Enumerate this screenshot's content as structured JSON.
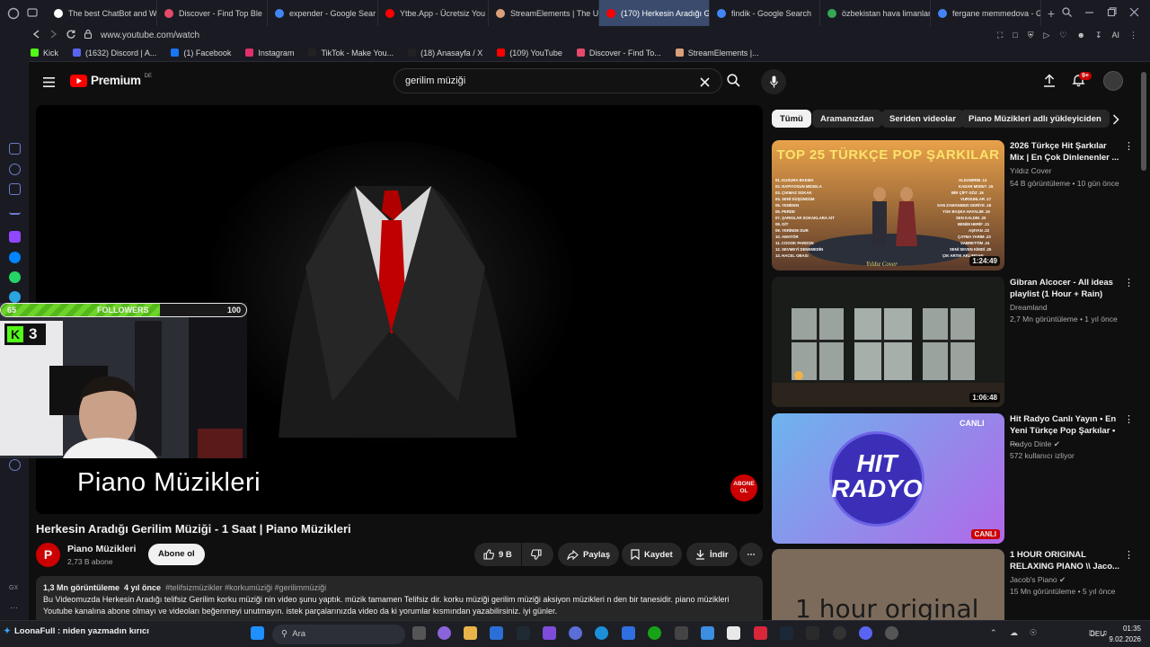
{
  "tabs": [
    {
      "label": "The best ChatBot and W",
      "color": "#ffffff",
      "active": false
    },
    {
      "label": "Discover - Find Top Ble",
      "color": "#e54a6a",
      "active": false
    },
    {
      "label": "expender - Google Sear",
      "color": "#4285f4",
      "active": false
    },
    {
      "label": "Ytbe.App - Ücretsiz You",
      "color": "#ff0000",
      "active": false
    },
    {
      "label": "StreamElements | The U",
      "color": "#d9a07a",
      "active": false
    },
    {
      "label": "(170) Herkesin Aradığı Ger",
      "color": "#ff0000",
      "active": true
    },
    {
      "label": "findik - Google Search",
      "color": "#4285f4",
      "active": false
    },
    {
      "label": "özbekistan hava limanları",
      "color": "#34a853",
      "active": false
    },
    {
      "label": "fergane memmedova - G",
      "color": "#4285f4",
      "active": false
    }
  ],
  "address": {
    "url": "www.youtube.com/watch",
    "ai_label": "AI"
  },
  "bookmarks": [
    {
      "label": "Kick",
      "color": "#53fc18"
    },
    {
      "label": "(1632) Discord | A...",
      "color": "#5865f2"
    },
    {
      "label": "(1) Facebook",
      "color": "#1877f2"
    },
    {
      "label": "Instagram",
      "color": "#e1306c"
    },
    {
      "label": "TikTok - Make You...",
      "color": "#222222"
    },
    {
      "label": "(18) Anasayfa / X",
      "color": "#222222"
    },
    {
      "label": "(109) YouTube",
      "color": "#ff0000"
    },
    {
      "label": "Discover - Find To...",
      "color": "#e54a6a"
    },
    {
      "label": "StreamElements |...",
      "color": "#d9a07a"
    }
  ],
  "youtube": {
    "logo": "Premium",
    "logo_region": "DE",
    "search_value": "gerilim müziği",
    "notif_badge": "9+"
  },
  "video": {
    "overlay_text": "Piano Müzikleri",
    "subscribe_badge": "ABONE OL",
    "title": "Herkesin Aradığı Gerilim Müziği - 1 Saat | Piano Müzikleri",
    "channel": "Piano Müzikleri",
    "channel_initial": "P",
    "subscribers": "2,73 B abone",
    "subscribe_label": "Abone ol",
    "likes": "9 B",
    "share": "Paylaş",
    "save": "Kaydet",
    "download": "İndir",
    "views": "1,3 Mn görüntüleme",
    "age": "4 yıl önce",
    "tags": "#telifsizmüzikler #korkumüziği #gerilimmüziği",
    "description": "Bu Videomuzda Herkesin Aradığı telifsiz Gerilim korku müziği nin video şunu yaptık. müzik tamamen Telifsiz dir. korku müziği gerilim müziği aksiyon müzikleri n den bir tanesidir. piano müzikleri Youtube kanalına abone olmayı ve videoları beğenmeyi unutmayın. istek parçalarınızda video da ki yorumlar kısmından yazabilirsiniz. iyi günler."
  },
  "overlay": {
    "followers_start": "65",
    "followers_label": "FOLLOWERS",
    "followers_goal": "100",
    "followers_progress": 0.65,
    "kick_count": "3"
  },
  "chips": [
    "Tümü",
    "Aramanızdan",
    "Seriden videolar",
    "Piano Müzikleri adlı yükleyiciden"
  ],
  "recommendations": [
    {
      "title": "2026 Türkçe Hit Şarkılar Mix | En Çok Dinlenenler ...",
      "channel": "Yıldız Cover",
      "meta": "54 B görüntüleme • 10 gün önce",
      "duration": "1:24:49",
      "thumb_text": "TOP 25 TÜRKÇE POP ŞARKILAR",
      "verified": false
    },
    {
      "title": "Gibran Alcocer - All ideas playlist (1 Hour + Rain)",
      "channel": "Dreamland",
      "meta": "2,7 Mn görüntüleme • 1 yıl önce",
      "duration": "1:06:48",
      "thumb_text": "",
      "verified": false
    },
    {
      "title": "Hit Radyo Canlı Yayın • En Yeni Türkçe Pop Şarkılar • ...",
      "channel": "Radyo Dinle",
      "meta": "572 kullanıcı izliyor",
      "duration": "CANLI",
      "thumb_text": "HIT RADYO",
      "verified": true
    },
    {
      "title": "1 HOUR ORIGINAL RELAXING PIANO \\\\ Jaco...",
      "channel": "Jacob's Piano",
      "meta": "15 Mn görüntüleme • 5 yıl önce",
      "duration": "",
      "thumb_text": "1 hour original",
      "verified": true
    }
  ],
  "live_badge": "CANLI",
  "ticker": "LoonaFull : niden yazmadın kırıcı",
  "taskbar": {
    "search": "Ara",
    "lang": "DEU",
    "time": "01:35",
    "date": "9.02.2026"
  }
}
